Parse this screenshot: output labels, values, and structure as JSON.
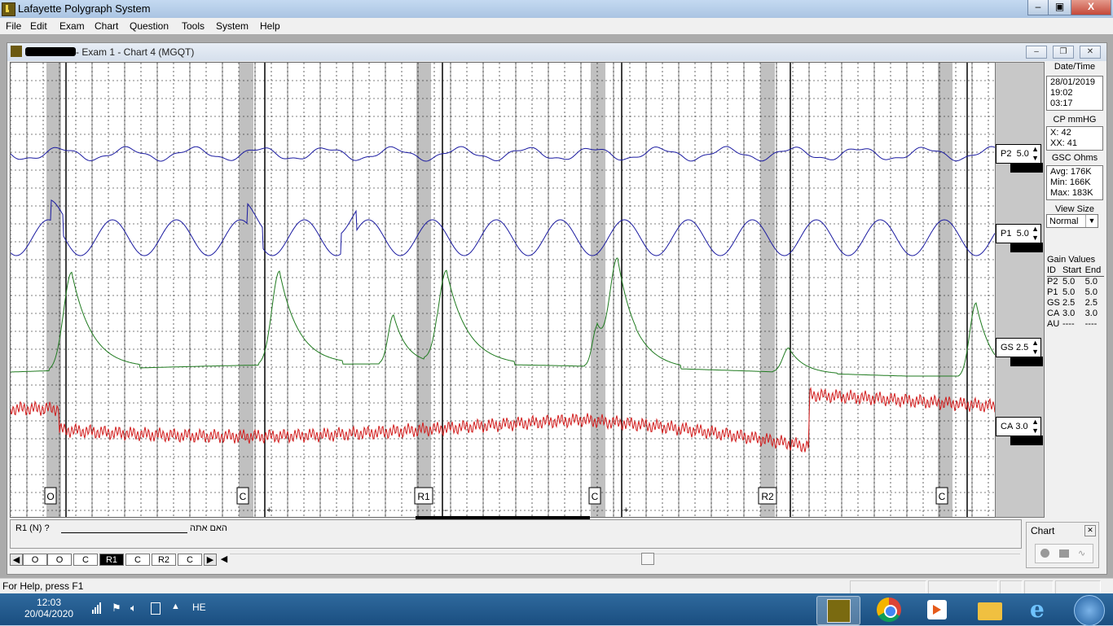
{
  "window": {
    "title": "Lafayette Polygraph System"
  },
  "menu": [
    "File",
    "Edit",
    "Exam",
    "Chart",
    "Question",
    "Tools",
    "System",
    "Help"
  ],
  "child": {
    "title": "- Exam 1 - Chart 4 (MGQT)"
  },
  "markers": [
    {
      "label": "O",
      "sign": "-"
    },
    {
      "label": "C",
      "sign": "+"
    },
    {
      "label": "R1",
      "sign": "-"
    },
    {
      "label": "C",
      "sign": "+"
    },
    {
      "label": "R2",
      "sign": "-"
    },
    {
      "label": "C",
      "sign": "-"
    }
  ],
  "channels": [
    {
      "id": "P2",
      "gain": "5.0"
    },
    {
      "id": "P1",
      "gain": "5.0"
    },
    {
      "id": "GS",
      "gain": "2.5"
    },
    {
      "id": "CA",
      "gain": "3.0"
    }
  ],
  "info": {
    "datetime_label": "Date/Time",
    "date": "28/01/2019",
    "time": "19:02",
    "elapsed": "03:17",
    "cp_label": "CP mmHG",
    "cp_x": "X:   42",
    "cp_xx": "XX:  41",
    "gsc_label": "GSC Ohms",
    "gsc_avg": "Avg: 176K",
    "gsc_min": "Min:  166K",
    "gsc_max": "Max: 183K",
    "view_size_label": "View Size",
    "view_size": "Normal"
  },
  "gain_values": {
    "title": "Gain Values",
    "cols": [
      "ID",
      "Start",
      "End"
    ],
    "rows": [
      [
        "P2",
        "5.0",
        "5.0"
      ],
      [
        "P1",
        "5.0",
        "5.0"
      ],
      [
        "GS",
        "2.5",
        "2.5"
      ],
      [
        "CA",
        "3.0",
        "3.0"
      ],
      [
        "AU",
        "----",
        "----"
      ]
    ]
  },
  "question": {
    "id": "R1 (N) ?",
    "text": "האם אתה"
  },
  "sequence": [
    "O",
    "O",
    "C",
    "R1",
    "C",
    "R2",
    "C"
  ],
  "sequence_active": "R1",
  "chart_panel": {
    "title": "Chart"
  },
  "status": {
    "help": "For Help, press F1"
  },
  "taskbar": {
    "time": "12:03",
    "date": "20/04/2020",
    "lang": "HE"
  },
  "colors": {
    "p2": "#1a1aa0",
    "p1": "#1a1aa0",
    "gs": "#1f7a1f",
    "ca": "#d11a1a",
    "band": "#c0c0c0"
  }
}
